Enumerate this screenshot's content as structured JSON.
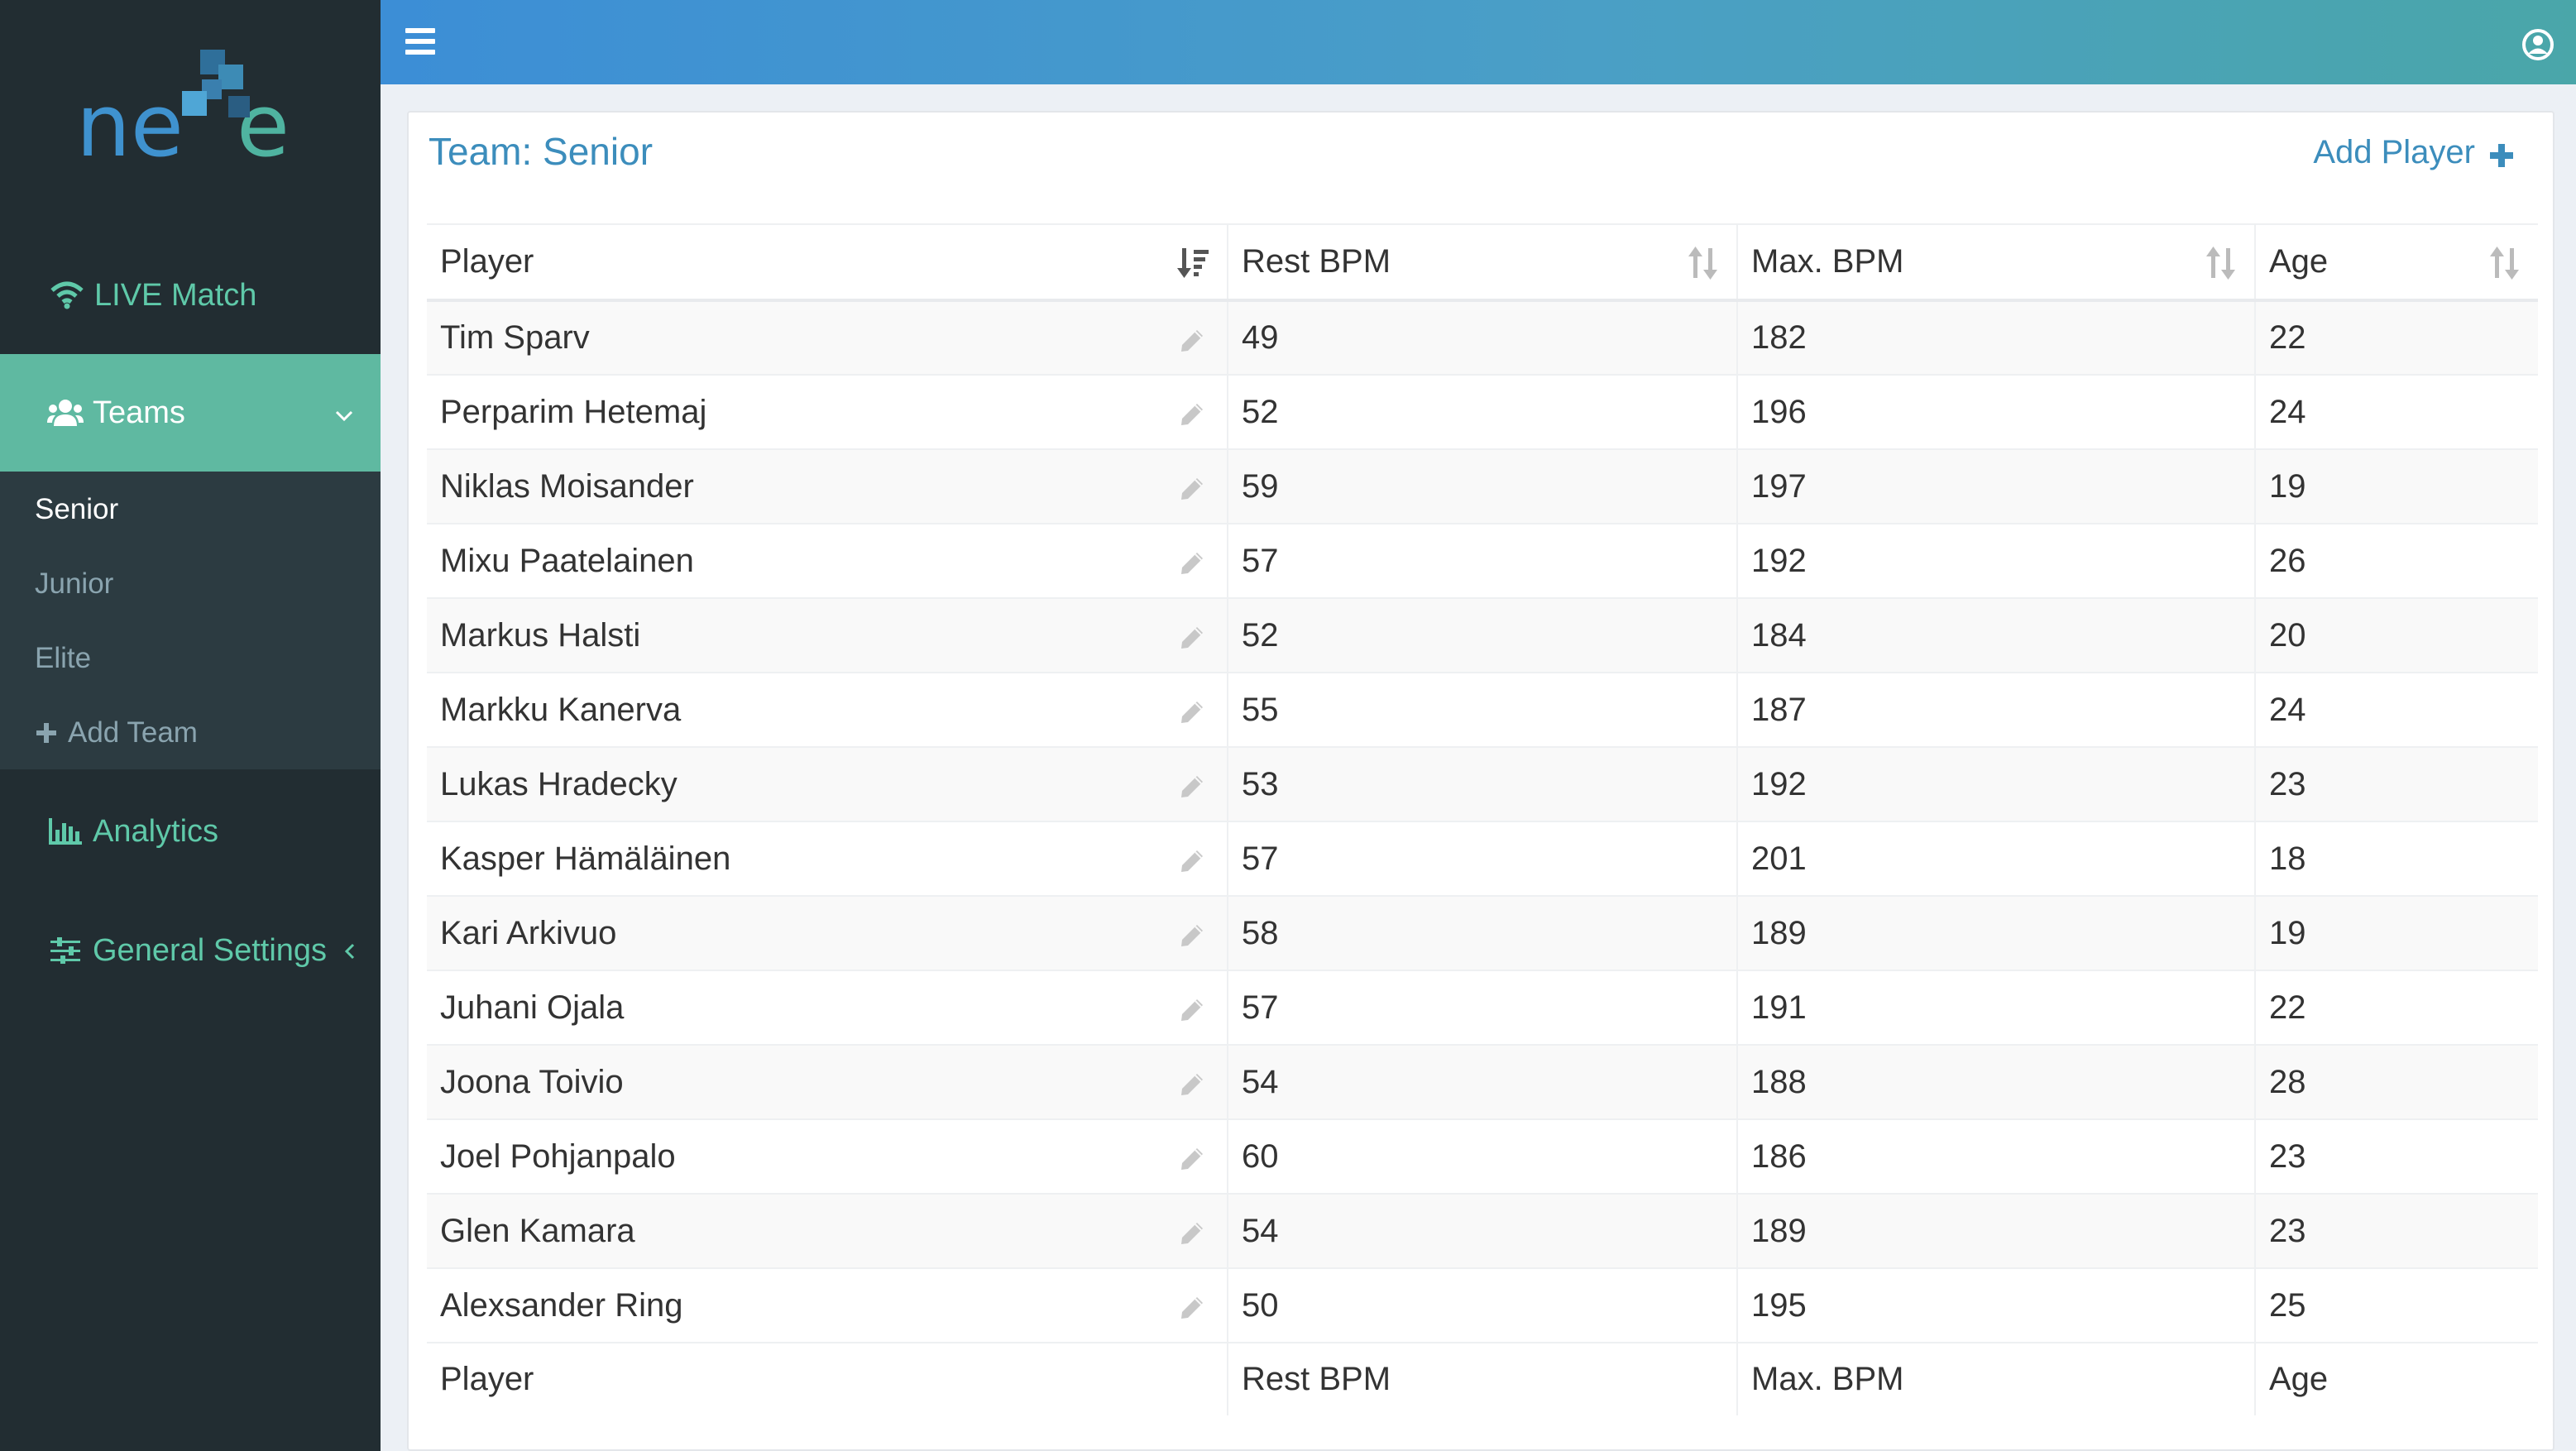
{
  "app": {
    "logo_text": "nexe",
    "accent_color": "#5fb9a1",
    "header_gradient": [
      "#3c8ed6",
      "#4aa6a9"
    ]
  },
  "sidebar": {
    "live_match": {
      "label": "LIVE Match",
      "icon": "wifi-icon"
    },
    "teams": {
      "label": "Teams",
      "icon": "users-icon",
      "expanded": true
    },
    "team_items": [
      {
        "label": "Senior",
        "active": true
      },
      {
        "label": "Junior",
        "active": false
      },
      {
        "label": "Elite",
        "active": false
      }
    ],
    "add_team": {
      "label": "Add Team",
      "icon": "plus-icon"
    },
    "analytics": {
      "label": "Analytics",
      "icon": "bar-chart-icon"
    },
    "general_settings": {
      "label": "General Settings",
      "icon": "sliders-icon"
    }
  },
  "header": {
    "menu_icon": "hamburger-icon",
    "user_icon": "user-circle-icon"
  },
  "main": {
    "title": "Team: Senior",
    "add_player_label": "Add Player",
    "columns": [
      "Player",
      "Rest BPM",
      "Max. BPM",
      "Age"
    ],
    "rows": [
      {
        "player": "Tim Sparv",
        "rest": "49",
        "max": "182",
        "age": "22"
      },
      {
        "player": "Perparim Hetemaj",
        "rest": "52",
        "max": "196",
        "age": "24"
      },
      {
        "player": "Niklas Moisander",
        "rest": "59",
        "max": "197",
        "age": "19"
      },
      {
        "player": "Mixu Paatelainen",
        "rest": "57",
        "max": "192",
        "age": "26"
      },
      {
        "player": "Markus Halsti",
        "rest": "52",
        "max": "184",
        "age": "20"
      },
      {
        "player": "Markku Kanerva",
        "rest": "55",
        "max": "187",
        "age": "24"
      },
      {
        "player": "Lukas Hradecky",
        "rest": "53",
        "max": "192",
        "age": "23"
      },
      {
        "player": "Kasper Hämäläinen",
        "rest": "57",
        "max": "201",
        "age": "18"
      },
      {
        "player": "Kari Arkivuo",
        "rest": "58",
        "max": "189",
        "age": "19"
      },
      {
        "player": "Juhani Ojala",
        "rest": "57",
        "max": "191",
        "age": "22"
      },
      {
        "player": "Joona Toivio",
        "rest": "54",
        "max": "188",
        "age": "28"
      },
      {
        "player": "Joel Pohjanpalo",
        "rest": "60",
        "max": "186",
        "age": "23"
      },
      {
        "player": "Glen Kamara",
        "rest": "54",
        "max": "189",
        "age": "23"
      },
      {
        "player": "Alexsander Ring",
        "rest": "50",
        "max": "195",
        "age": "25"
      }
    ]
  }
}
